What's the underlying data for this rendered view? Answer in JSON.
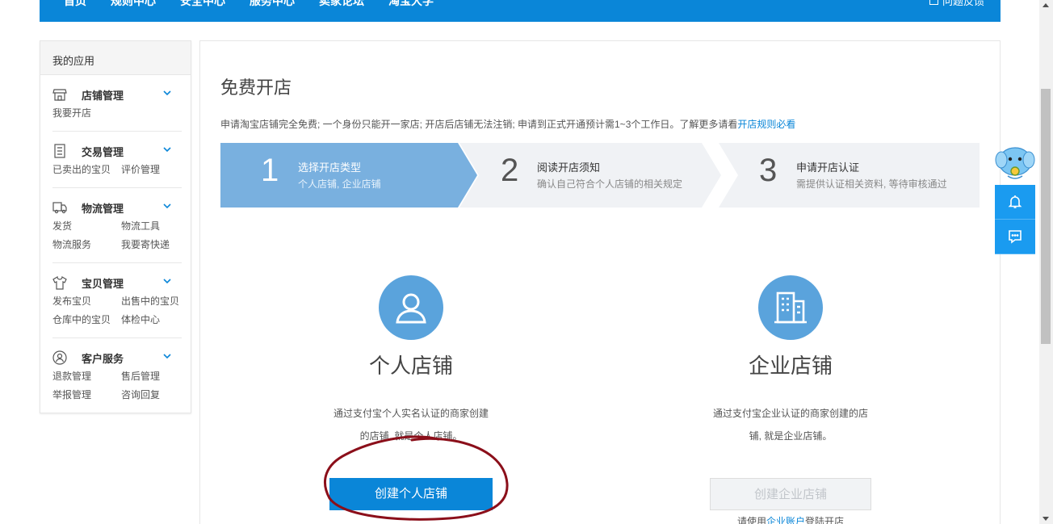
{
  "topnav": {
    "links": [
      "首页",
      "规则中心",
      "安全中心",
      "服务中心",
      "卖家论坛",
      "淘宝大学"
    ],
    "feedback": "问题反馈"
  },
  "sidebar": {
    "header": "我的应用",
    "groups": [
      {
        "label": "店铺管理",
        "icon": "store-icon",
        "items": [
          "我要开店"
        ]
      },
      {
        "label": "交易管理",
        "icon": "receipt-icon",
        "items": [
          "已卖出的宝贝",
          "评价管理"
        ]
      },
      {
        "label": "物流管理",
        "icon": "truck-icon",
        "items": [
          "发货",
          "物流工具",
          "物流服务",
          "我要寄快递"
        ]
      },
      {
        "label": "宝贝管理",
        "icon": "shirt-icon",
        "items": [
          "发布宝贝",
          "出售中的宝贝",
          "仓库中的宝贝",
          "体检中心"
        ]
      },
      {
        "label": "客户服务",
        "icon": "customer-icon",
        "items": [
          "退款管理",
          "售后管理",
          "举报管理",
          "咨询回复"
        ]
      }
    ]
  },
  "main": {
    "title": "免费开店",
    "desc": "申请淘宝店铺完全免费; 一个身份只能开一家店; 开店后店铺无法注销; 申请到正式开通预计需1~3个工作日。了解更多请看",
    "desc_link": "开店规则必看",
    "steps": [
      {
        "num": "1",
        "title": "选择开店类型",
        "sub": "个人店铺, 企业店铺",
        "active": true
      },
      {
        "num": "2",
        "title": "阅读开店须知",
        "sub": "确认自己符合个人店铺的相关规定",
        "active": false
      },
      {
        "num": "3",
        "title": "申请开店认证",
        "sub": "需提供认证相关资料, 等待审核通过",
        "active": false
      }
    ],
    "personal": {
      "title": "个人店铺",
      "desc1": "通过支付宝个人实名认证的商家创建",
      "desc2": "的店铺, 就是个人店铺。",
      "button": "创建个人店铺"
    },
    "enterprise": {
      "title": "企业店铺",
      "desc1": "通过支付宝企业认证的商家创建的店",
      "desc2": "铺, 就是企业店铺。",
      "button": "创建企业店铺",
      "hint_pre": "请使用",
      "hint_link": "企业账户",
      "hint_post": "登陆开店"
    }
  },
  "colors": {
    "brand": "#0a86d8",
    "step_active": "#79b0df",
    "step_inactive": "#f0f2f5",
    "annotation": "#8b0f1a"
  }
}
